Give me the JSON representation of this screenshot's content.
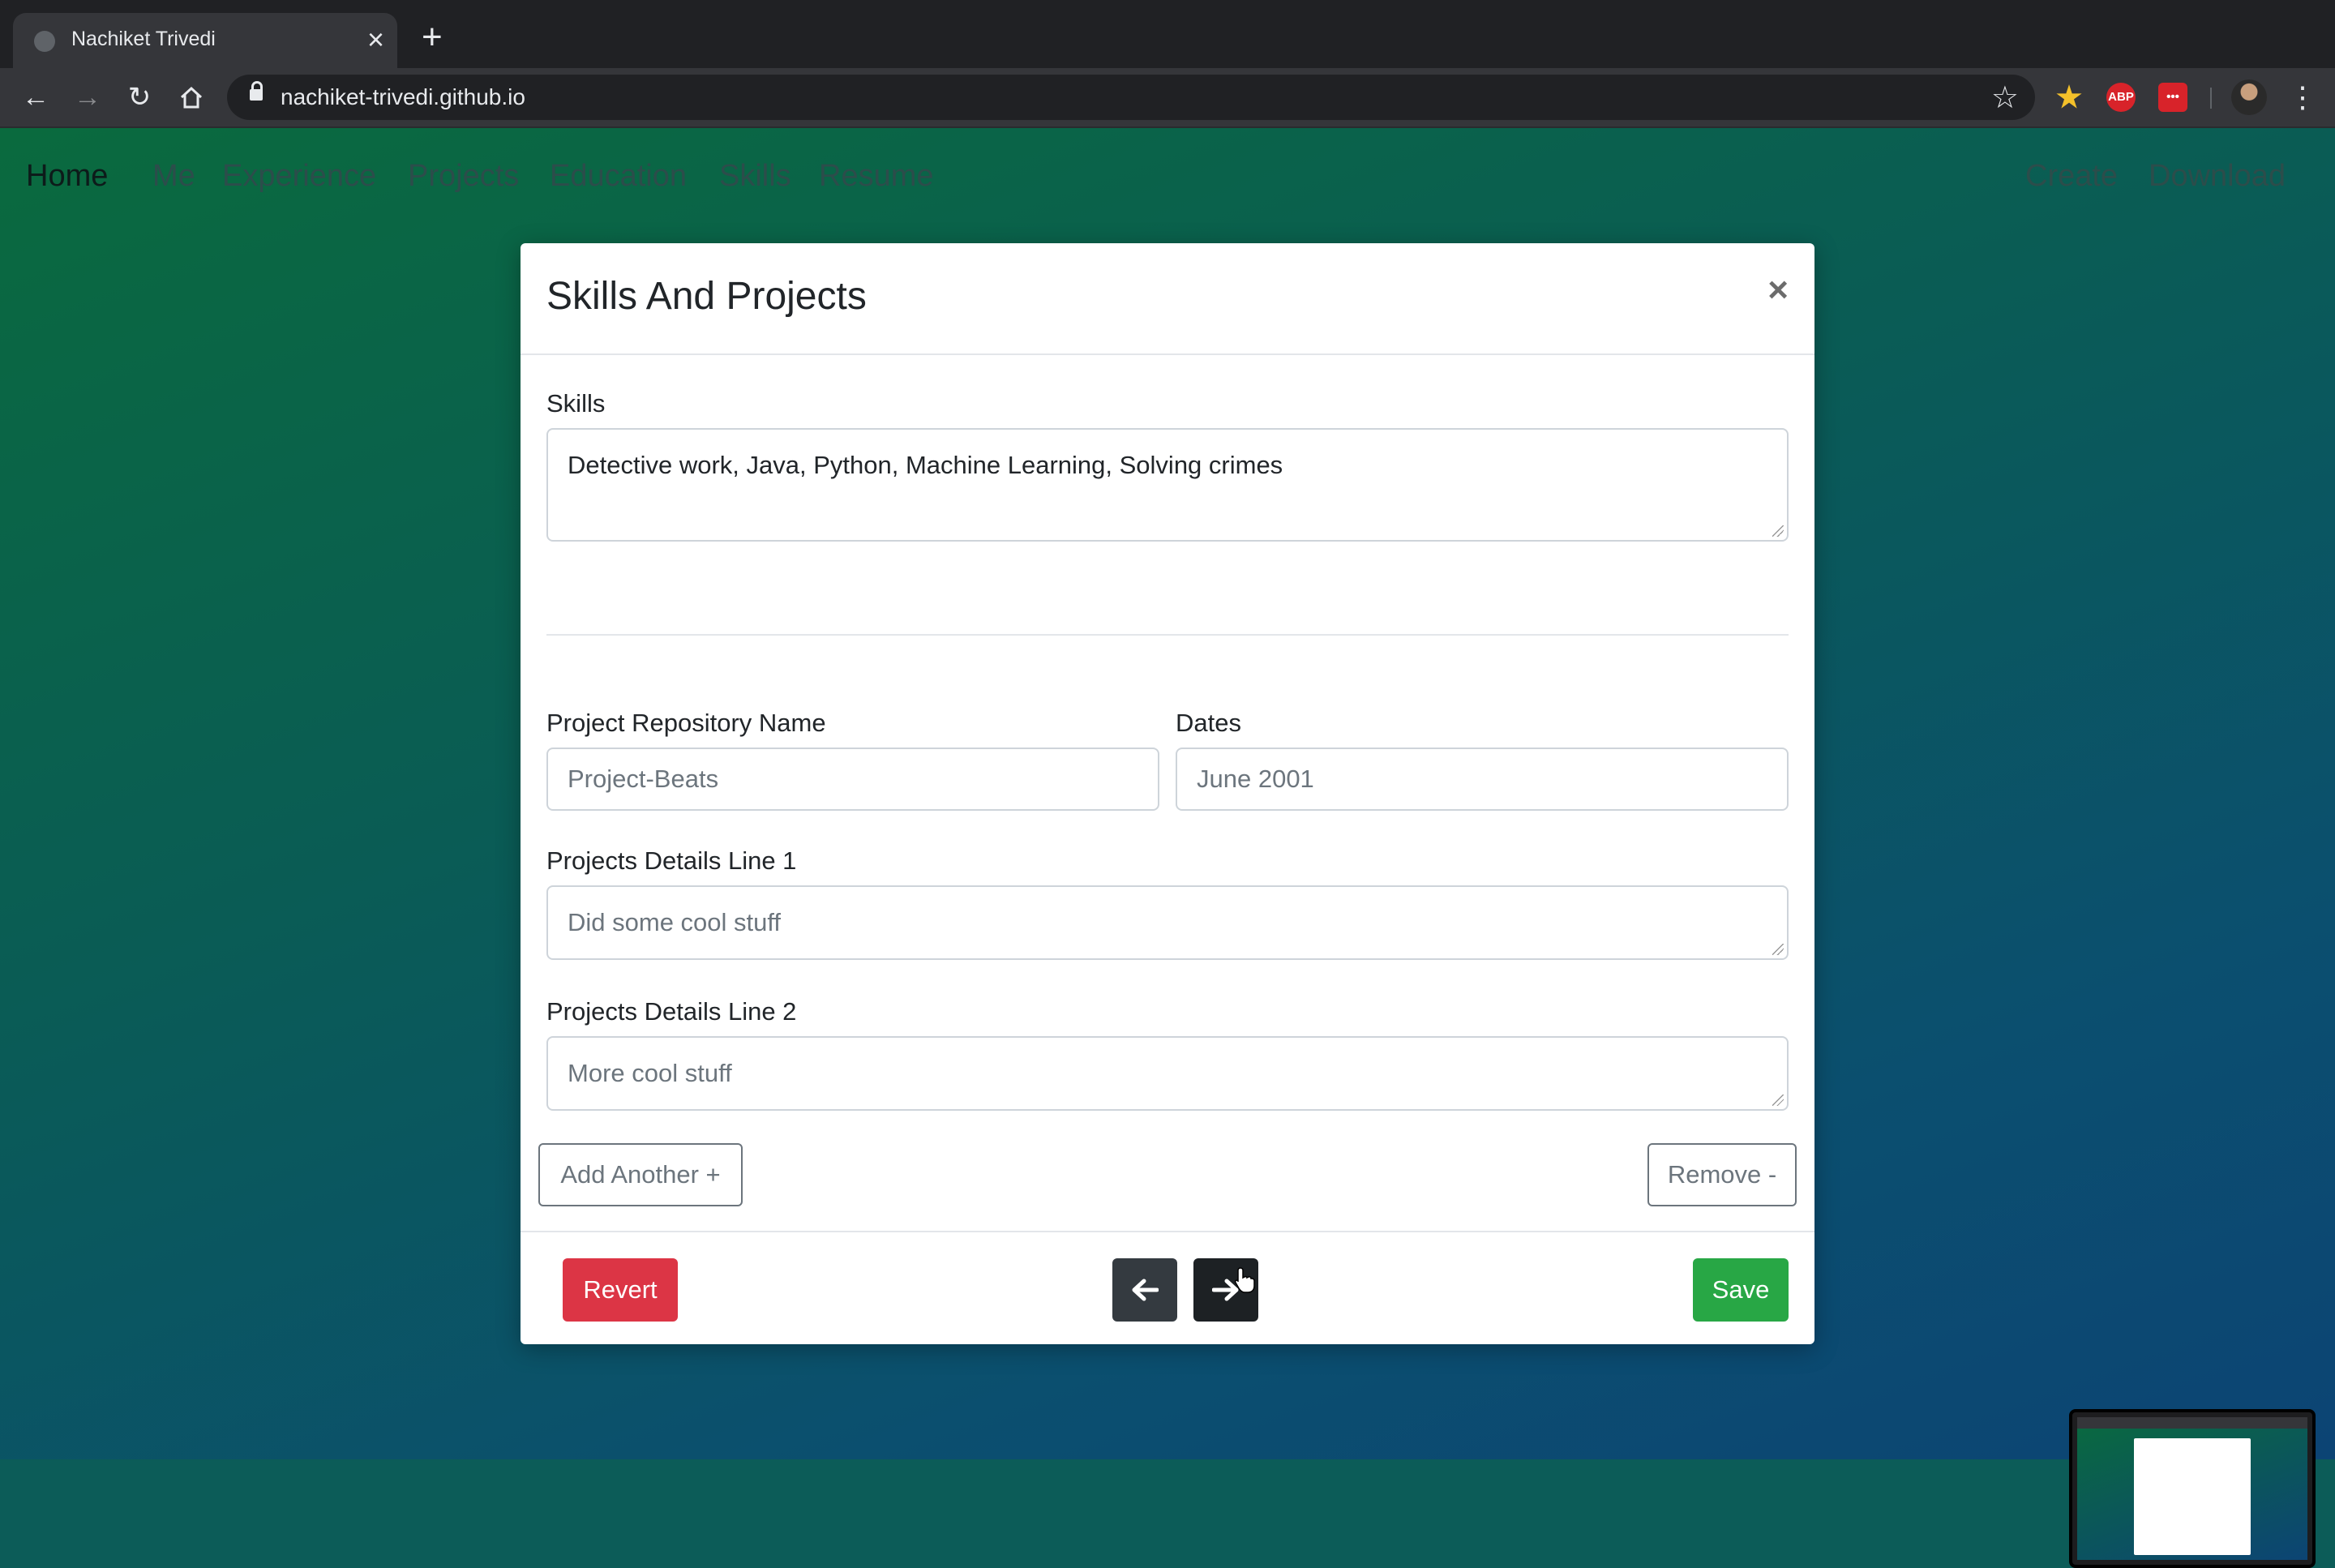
{
  "browser": {
    "tab_title": "Nachiket Trivedi",
    "tab_close": "×",
    "new_tab": "+",
    "url": "nachiket-trivedi.github.io",
    "ext_abp": "ABP",
    "ext_lastpass": "•••"
  },
  "site_nav": {
    "brand": "Home",
    "links": [
      "Me",
      "Experience",
      "Projects",
      "Education",
      "Skills",
      "Resume"
    ],
    "right_links": [
      "Create",
      "Download"
    ]
  },
  "modal": {
    "title": "Skills And Projects",
    "close": "×",
    "skills": {
      "label": "Skills",
      "value": "Detective work, Java, Python, Machine Learning, Solving crimes"
    },
    "project": {
      "repo_label": "Project Repository Name",
      "repo_placeholder": "Project-Beats",
      "dates_label": "Dates",
      "dates_placeholder": "June 2001",
      "line1_label": "Projects Details Line 1",
      "line1_placeholder": "Did some cool stuff",
      "line2_label": "Projects Details Line 2",
      "line2_placeholder": "More cool stuff"
    },
    "add_another": "Add Another +",
    "remove": "Remove -",
    "footer": {
      "revert": "Revert",
      "prev_icon": "arrow-left-icon",
      "next_icon": "arrow-right-icon",
      "save": "Save"
    }
  },
  "colors": {
    "danger": "#dc3545",
    "success": "#28a745",
    "dark": "#343a40"
  }
}
